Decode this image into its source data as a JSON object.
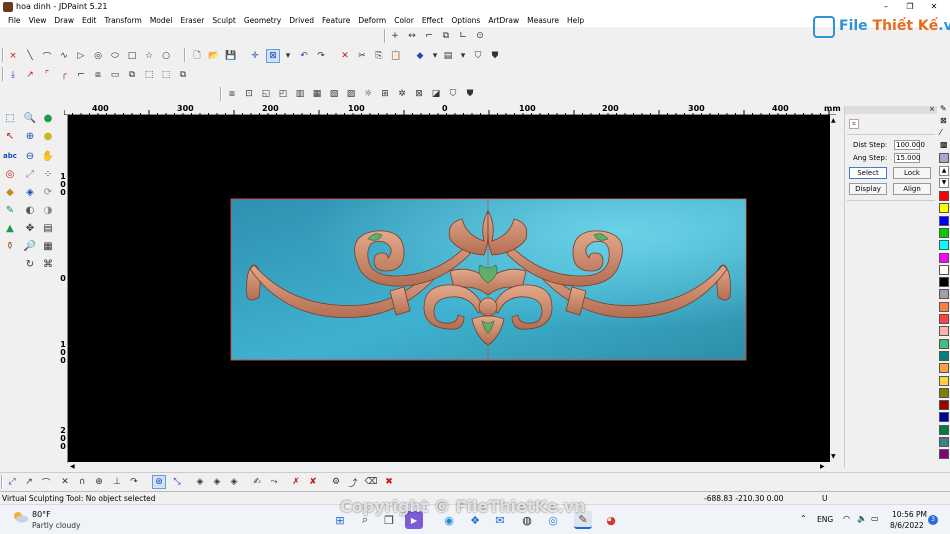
{
  "window": {
    "title": "hoa dinh - JDPaint 5.21",
    "minimize": "–",
    "maximize": "❐",
    "close": "✕"
  },
  "menu": [
    "File",
    "View",
    "Draw",
    "Edit",
    "Transform",
    "Model",
    "Eraser",
    "Sculpt",
    "Geometry",
    "Drived",
    "Feature",
    "Deform",
    "Color",
    "Effect",
    "Options",
    "ArtDraw",
    "Measure",
    "Help"
  ],
  "logo": {
    "text_main": "File",
    "text_accent": "Thiết Kế",
    "text_suffix": ".vn"
  },
  "ruler": {
    "h_labels": [
      "400",
      "300",
      "200",
      "100",
      "0",
      "100",
      "200",
      "300",
      "400"
    ],
    "unit": "mm",
    "v_labels": [
      "100",
      "0",
      "100",
      "200"
    ]
  },
  "right_panel": {
    "dist_step_label": "Dist Step:",
    "dist_step_value": "100.000",
    "ang_step_label": "Ang Step:",
    "ang_step_value": "15.000",
    "buttons": [
      "Select",
      "Lock",
      "Display",
      "Align"
    ]
  },
  "palette_colors": [
    "#ff0000",
    "#ffff00",
    "#0000ff",
    "#00cc00",
    "#00ffff",
    "#ff00ff",
    "#ffffff",
    "#000000",
    "#a0a0a0",
    "#ff8040",
    "#ff4040",
    "#ffb0b0",
    "#40c080",
    "#008080",
    "#ffa040",
    "#ffd040",
    "#808000",
    "#a00000",
    "#0000a0",
    "#008040",
    "#408080",
    "#800080"
  ],
  "status": {
    "text": "Virtual Sculpting Tool: No object selected",
    "coords": "-688.83 -210.30 0.00",
    "extra": "U"
  },
  "taskbar": {
    "temperature": "80°F",
    "condition": "Partly cloudy",
    "language": "ENG",
    "time": "10:56 PM",
    "date": "8/6/2022",
    "notification_count": "3"
  },
  "watermark": "Copyright © FileThietKe.vn",
  "colors": {
    "canvas_bg": "#000000",
    "relief_bg": "#3aa7c5",
    "relief_motif": "#c98a6a"
  }
}
